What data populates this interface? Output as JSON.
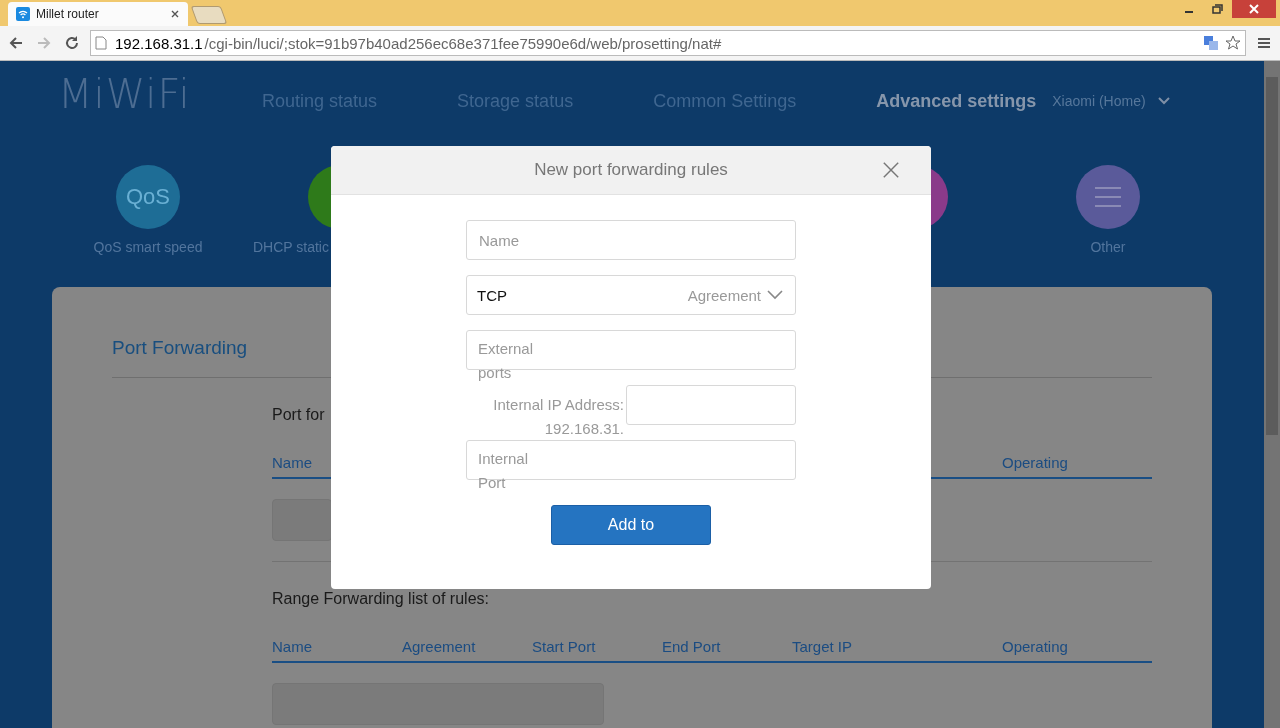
{
  "browser": {
    "tab_title": "Millet router",
    "url_host": "192.168.31.1",
    "url_path": "/cgi-bin/luci/;stok=91b97b40ad256ec68e371fee75990e6d/web/prosetting/nat#"
  },
  "header": {
    "logo": "MiWiFi",
    "nav": [
      {
        "label": "Routing status",
        "selected": false
      },
      {
        "label": "Storage status",
        "selected": false
      },
      {
        "label": "Common Settings",
        "selected": false
      },
      {
        "label": "Advanced settings",
        "selected": true
      }
    ],
    "account": "Xiaomi (Home)"
  },
  "tools": [
    {
      "kind": "qos",
      "icon_text": "QoS",
      "label": "QoS smart speed",
      "color": "#1e6d96"
    },
    {
      "kind": "dhcp",
      "label": "DHCP static",
      "color": "#2e7a1a"
    },
    {
      "kind": "vpn",
      "color": "#8a3a8a"
    },
    {
      "kind": "other",
      "label": "Other",
      "color": "#5a5a9a"
    }
  ],
  "card": {
    "title": "Port Forwarding",
    "port_section": {
      "title": "Port for",
      "columns": [
        "Name",
        "Operating"
      ]
    },
    "range_section": {
      "title": "Range Forwarding list of rules:",
      "columns": [
        "Name",
        "Agreement",
        "Start Port",
        "End Port",
        "Target IP",
        "Operating"
      ]
    }
  },
  "dialog": {
    "title": "New port forwarding rules",
    "name_field": {
      "placeholder": "Name"
    },
    "protocol_field": {
      "value": "TCP",
      "label": "Agreement"
    },
    "external_field": {
      "placeholder": "External ports"
    },
    "ip_field": {
      "label": "Internal IP Address:",
      "prefix": "192.168.31."
    },
    "internal_field": {
      "placeholder": "Internal Port"
    },
    "submit": "Add to"
  }
}
